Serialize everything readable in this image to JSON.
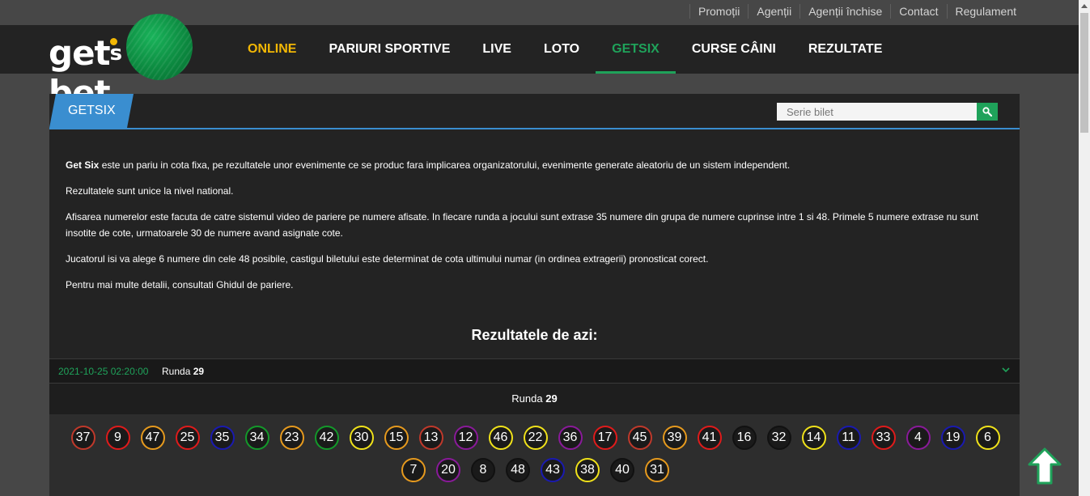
{
  "toplinks": [
    "Promoții",
    "Agenții",
    "Agenții închise",
    "Contact",
    "Regulament"
  ],
  "logo": {
    "text_left": "get",
    "text_right": "bet",
    "mark": "s"
  },
  "nav": [
    {
      "label": "ONLINE"
    },
    {
      "label": "PARIURI SPORTIVE"
    },
    {
      "label": "LIVE"
    },
    {
      "label": "LOTO"
    },
    {
      "label": "GETSIX"
    },
    {
      "label": "CURSE CÂINI"
    },
    {
      "label": "REZULTATE"
    }
  ],
  "panel": {
    "tab_label": "GETSIX",
    "search_placeholder": "Serie bilet"
  },
  "description": {
    "p1_bold": "Get Six",
    "p1_rest": " este un pariu in cota fixa, pe rezultatele unor evenimente ce se produc fara implicarea organizatorului, evenimente generate aleatoriu de un sistem independent.",
    "p2": "Rezultatele sunt unice la nivel national.",
    "p3": "Afisarea numerelor este facuta de catre sistemul video de pariere pe numere afisate. In fiecare runda a jocului sunt extrase 35 numere din grupa de numere cuprinse intre 1 si 48. Primele 5 numere extrase nu sunt insotite de cote, urmatoarele 30 de numere avand asignate cote.",
    "p4": "Jucatorul isi va alege 6 numere din cele 48 posibile, castigul biletului este determinat de cota ultimului numar (in ordinea extragerii) pronosticat corect.",
    "p5": "Pentru mai multe detalii, consultati Ghidul de pariere."
  },
  "results": {
    "title": "Rezultatele de azi:",
    "round_datetime": "2021-10-25 02:20:00",
    "round_prefix": "Runda",
    "round_number": "29",
    "balls": [
      {
        "n": "37",
        "c": "#c0392b"
      },
      {
        "n": "9",
        "c": "#e01b1b"
      },
      {
        "n": "47",
        "c": "#e69a1e"
      },
      {
        "n": "25",
        "c": "#e01b1b"
      },
      {
        "n": "35",
        "c": "#1a1ab0"
      },
      {
        "n": "34",
        "c": "#139a2a"
      },
      {
        "n": "23",
        "c": "#e69a1e"
      },
      {
        "n": "42",
        "c": "#139a2a"
      },
      {
        "n": "30",
        "c": "#f0e21a"
      },
      {
        "n": "15",
        "c": "#e69a1e"
      },
      {
        "n": "13",
        "c": "#c0392b"
      },
      {
        "n": "12",
        "c": "#8a1a9a"
      },
      {
        "n": "46",
        "c": "#f0e21a"
      },
      {
        "n": "22",
        "c": "#f0e21a"
      },
      {
        "n": "36",
        "c": "#8a1a9a"
      },
      {
        "n": "17",
        "c": "#e01b1b"
      },
      {
        "n": "45",
        "c": "#c0392b"
      },
      {
        "n": "39",
        "c": "#e69a1e"
      },
      {
        "n": "41",
        "c": "#e01b1b"
      },
      {
        "n": "16",
        "c": "#111111"
      },
      {
        "n": "32",
        "c": "#111111"
      },
      {
        "n": "14",
        "c": "#f0e21a"
      },
      {
        "n": "11",
        "c": "#1a1ab0"
      },
      {
        "n": "33",
        "c": "#e01b1b"
      },
      {
        "n": "4",
        "c": "#8a1a9a"
      },
      {
        "n": "19",
        "c": "#1a1ab0"
      },
      {
        "n": "6",
        "c": "#f0e21a"
      },
      {
        "n": "7",
        "c": "#e69a1e"
      },
      {
        "n": "20",
        "c": "#8a1a9a"
      },
      {
        "n": "8",
        "c": "#111111"
      },
      {
        "n": "48",
        "c": "#111111"
      },
      {
        "n": "43",
        "c": "#1a1ab0"
      },
      {
        "n": "38",
        "c": "#f0e21a"
      },
      {
        "n": "40",
        "c": "#111111"
      },
      {
        "n": "31",
        "c": "#e69a1e"
      }
    ]
  },
  "icons": {
    "search": "search-icon",
    "chevron": "chevron-down-icon",
    "to_top": "arrow-up-icon"
  },
  "colors": {
    "accent_green": "#1fa25a",
    "accent_yellow": "#f2b705",
    "accent_blue": "#3a8ed0"
  }
}
